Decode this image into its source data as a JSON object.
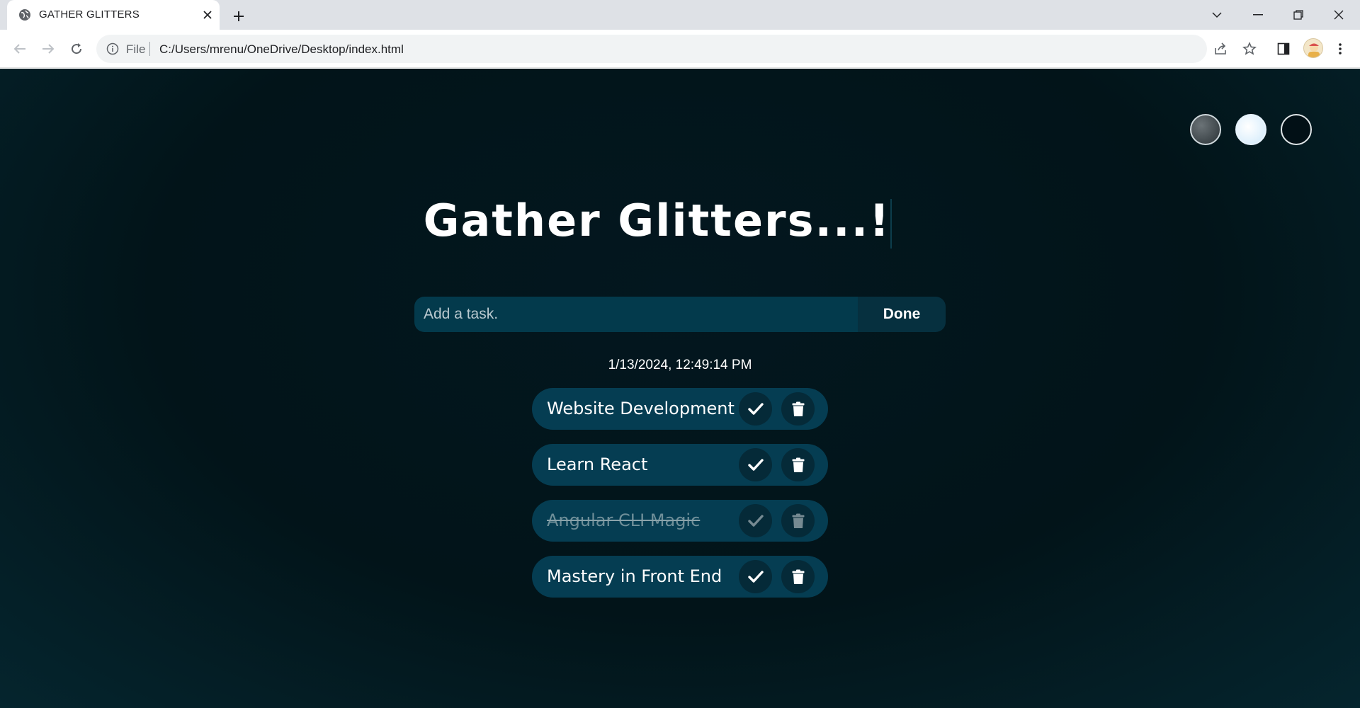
{
  "browser": {
    "tab_title": "GATHER GLITTERS",
    "omnibox_scheme_label": "File",
    "url": "C:/Users/mrenu/OneDrive/Desktop/index.html"
  },
  "page": {
    "title": "Gather Glitters...!",
    "input_placeholder": "Add a task.",
    "input_value": "",
    "submit_label": "Done",
    "datetime": "1/13/2024, 12:49:14 PM",
    "theme_options": [
      "dark-gray",
      "light",
      "dark"
    ],
    "tasks": [
      {
        "text": "Website Development",
        "completed": false
      },
      {
        "text": "Learn React",
        "completed": false
      },
      {
        "text": "Angular CLI Magic",
        "completed": true
      },
      {
        "text": "Mastery in Front End",
        "completed": false
      }
    ]
  },
  "colors": {
    "background": "#021419",
    "accent": "#053d52",
    "input": "#033a4c"
  }
}
